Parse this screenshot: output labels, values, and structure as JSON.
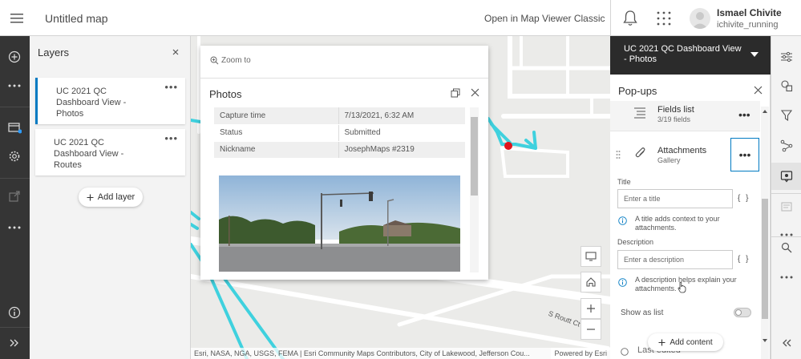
{
  "header": {
    "map_title": "Untitled map",
    "open_classic": "Open in Map Viewer Classic",
    "user_name": "Ismael Chivite",
    "user_id": "ichivite_running"
  },
  "layers_panel": {
    "title": "Layers",
    "layers": [
      {
        "label": "UC 2021 QC Dashboard View - Photos"
      },
      {
        "label": "UC 2021 QC Dashboard View - Routes"
      }
    ],
    "add_layer": "Add layer"
  },
  "popup": {
    "zoom_to": "Zoom to",
    "title": "Photos",
    "attributes": [
      {
        "field": "Capture time",
        "value": "7/13/2021, 6:32 AM"
      },
      {
        "field": "Status",
        "value": "Submitted"
      },
      {
        "field": "Nickname",
        "value": "JosephMaps #2319"
      }
    ]
  },
  "map": {
    "street_label": "S Routt Ct",
    "attribution": "Esri, NASA, NGA, USGS, FEMA | Esri Community Maps Contributors, City of Lakewood, Jefferson Cou...",
    "powered_by": "Powered by Esri"
  },
  "right_panel": {
    "layer_select": "UC 2021 QC Dashboard View - Photos",
    "title": "Pop-ups",
    "fields_list": {
      "label": "Fields list",
      "sub": "3/19 fields"
    },
    "attachments": {
      "label": "Attachments",
      "sub": "Gallery"
    },
    "title_field": {
      "label": "Title",
      "placeholder": "Enter a title",
      "help": "A title adds context to your attachments."
    },
    "description_field": {
      "label": "Description",
      "placeholder": "Enter a description",
      "help": "A description helps explain your attachments."
    },
    "expression_button": "{ }",
    "show_as_list": "Show as list",
    "show_as_list_on": false,
    "add_content": "Add content",
    "last_edited": "Last edited"
  },
  "colors": {
    "accent": "#007ac2",
    "route_line": "#3fd1de",
    "point": "#e0141c",
    "dark_header": "#2b2b2b",
    "left_bar": "#353535"
  }
}
